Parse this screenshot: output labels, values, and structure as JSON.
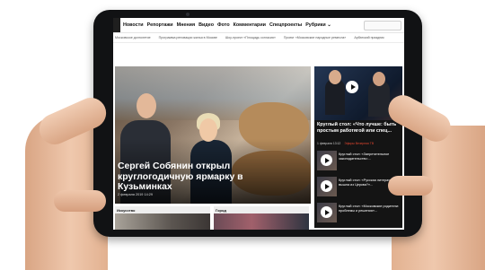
{
  "nav": {
    "items": [
      "Новости",
      "Репортажи",
      "Мнения",
      "Видео",
      "Фото",
      "Комментарии",
      "Спецпроекты",
      "Рубрики ⌄"
    ]
  },
  "subnav": {
    "items": [
      "Московское долголетие",
      "Программа реновации жилья в Москве",
      "Шоу-проект «Площадь согласия»",
      "Проект «Московские народные ремесла»",
      "Арбатский праздник"
    ]
  },
  "hero": {
    "title": "Сергей Собянин открыл круглогодичную ярмарку в Кузьминках",
    "date": "2 февраля 2019 14:29"
  },
  "side": {
    "title": "Круглый стол: «Что лучше: быть простым работягой или спец...",
    "date": "1 февраля 13:12",
    "tag": "Эфиры Вечерняя ТВ",
    "videos": [
      "Круглый стол: «Запретительное законодательство:...",
      "Круглый стол: «Русская литература вышла из Церкви?»...",
      "Круглый стол: «Московские родители: проблемы и решения»..."
    ]
  },
  "cards": [
    {
      "label": "Искусство"
    },
    {
      "label": "Город"
    }
  ]
}
